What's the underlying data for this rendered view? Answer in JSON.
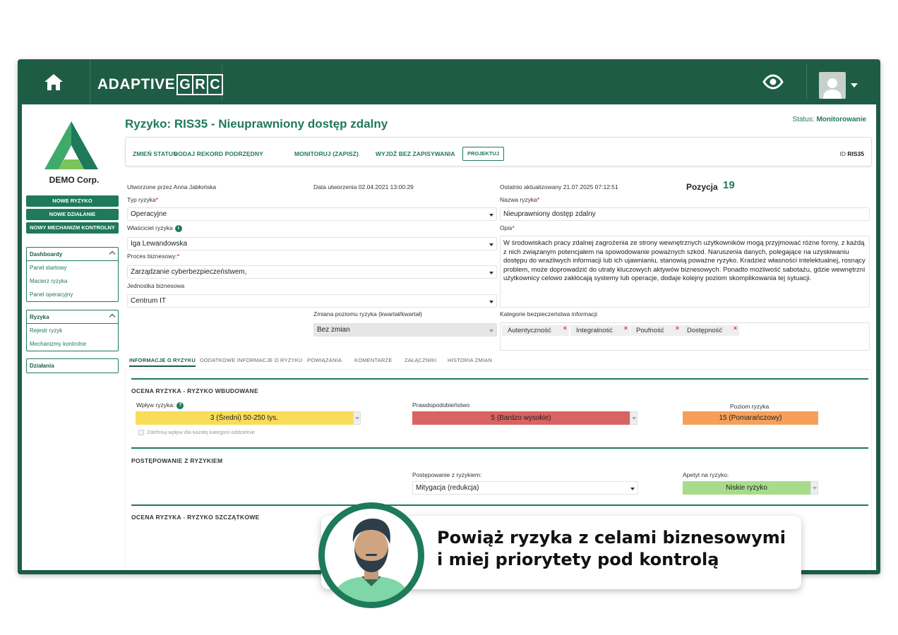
{
  "app": {
    "brand_main": "ADAPTIVE",
    "brand_grc": [
      "G",
      "R",
      "C"
    ]
  },
  "sidebar": {
    "company_name": "DEMO Corp.",
    "buttons": [
      "NOWE RYZYKO",
      "NOWE DZIAŁANIE",
      "NOWY MECHANIZM KONTROLNY"
    ],
    "groups": [
      {
        "title": "Dashboardy",
        "items": [
          "Panel startowy",
          "Macierz ryzyka",
          "Panel operacyjny"
        ]
      },
      {
        "title": "Ryzyka",
        "items": [
          "Rejestr ryzyk",
          "Mechanizmy kontrolne"
        ]
      },
      {
        "title": "Działania",
        "items": []
      }
    ]
  },
  "header": {
    "title": "Ryzyko: RIS35 - Nieuprawniony dostęp zdalny",
    "status_label": "Status:",
    "status_value": "Monitorowanie"
  },
  "actions": {
    "change_status": "ZMIEŃ STATUS",
    "add_child": "DODAJ REKORD PODRZĘDNY",
    "monitor": "MONITORUJ (ZAPISZ)",
    "exit": "WYJDŹ BEZ ZAPISYWANIA",
    "projektuj": "PROJEKTUJ",
    "id_label": "ID",
    "id_value": "RIS35"
  },
  "meta": {
    "created_by": "Utworzone przez Anna Jabłońska",
    "created_date": "Data utworzenia 02.04.2021 13:00:29",
    "updated": "Ostatnio aktualizowany 21.07.2025 07:12:51",
    "position_label": "Pozycja",
    "position_value": "19"
  },
  "form": {
    "risk_type_label": "Typ ryzyka",
    "risk_type": "Operacyjne",
    "owner_label": "Właściciel ryzyka",
    "owner": "Iga Lewandowska",
    "process_label": "Proces biznesowy:",
    "process": "Zarządzanie cyberbezpieczeństwem,",
    "unit_label": "Jednostka biznesowa",
    "unit": "Centrum IT",
    "change_label": "Zmiana poziomu ryzyka (kwartał/kwartał)",
    "change": "Bez zmian",
    "name_label": "Nazwa ryzyka",
    "name": "Nieuprawniony dostęp zdalny",
    "desc_label": "Opis",
    "description": "W środowiskach pracy zdalnej zagrożenia ze strony wewnętrznych użytkowników mogą przyjmować różne formy, z każdą z nich związanym potencjałem na spowodowanie poważnych szkód. Naruszenia danych, polegające na uzyskiwaniu dostępu do wrażliwych informacji lub ich ujawnianiu, stanowią poważne ryzyko. Kradzież własności intelektualnej, rosnący problem, może doprowadzić do utraty kluczowych aktywów biznesowych. Ponadto możliwość sabotażu, gdzie wewnętrzni użytkownicy celowo zakłócają systemy lub operacje, dodaje kolejny poziom skomplikowania tej sytuacji.",
    "categories_label": "Kategorie bezpieczeństwa informacji",
    "categories": [
      "Autentyczność",
      "Integralność",
      "Poufność",
      "Dostępność"
    ]
  },
  "tabs": [
    "INFORMACJE O RYZYKU",
    "DODATKOWE INFORMACJE O RYZYKU",
    "POWIĄZANIA",
    "KOMENTARZE",
    "ZAŁĄCZNIKI",
    "HISTORIA ZMIAN"
  ],
  "assessment": {
    "inherent_title": "OCENA RYZYKA - RYZYKO WBUDOWANE",
    "impact_label": "Wpływ ryzyka:",
    "impact": "3 (Średni) 50-250 tys.",
    "probability_label": "Prawdopodobieństwo",
    "probability": "5 (Bardzo wysokie)",
    "level_label": "Poziom ryzyka",
    "level": "15 (Pomarańczowy)",
    "per_category": "Zdefiniuj wpływ dla każdej kategorii oddzielnie",
    "treatment_title": "POSTĘPOWANIE Z RYZYKIEM",
    "treatment_label": "Postępowanie z ryzykiem:",
    "treatment": "Mitygacja (redukcja)",
    "appetite_label": "Apetyt na ryzyko:",
    "appetite": "Niskie ryzyko",
    "residual_title": "OCENA RYZYKA - RYZYKO SZCZĄTKOWE"
  },
  "colors": {
    "brand": "#1e5c45",
    "accent": "#1e7a5a",
    "impact": "#f8dc5a",
    "probability": "#d96262",
    "level": "#f5a05a",
    "appetite": "#a8dc8c"
  },
  "callout": {
    "line1": "Powiąż ryzyka z celami biznesowymi",
    "line2": "i miej priorytety pod kontrolą"
  }
}
